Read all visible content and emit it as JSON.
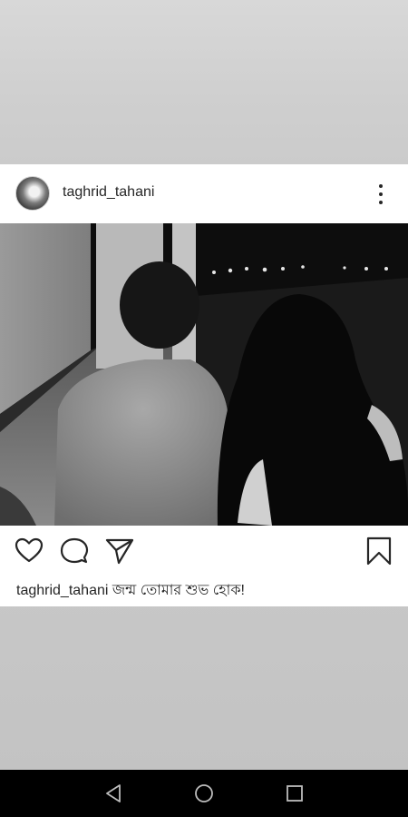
{
  "post": {
    "username": "taghrid_tahani",
    "caption_user": "taghrid_tahani",
    "caption_text": " জন্ম তোমার শুভ হোক!"
  },
  "icons": {
    "avatar": "avatar-image",
    "more": "more-vertical-icon",
    "like": "heart-icon",
    "comment": "comment-icon",
    "share": "send-icon",
    "save": "bookmark-icon",
    "nav_back": "back-triangle-icon",
    "nav_home": "home-circle-icon",
    "nav_recent": "recent-square-icon"
  },
  "colors": {
    "text": "#262626",
    "card_bg": "#ffffff",
    "nav_bg": "#000000",
    "nav_icon": "#bdbdbd"
  }
}
